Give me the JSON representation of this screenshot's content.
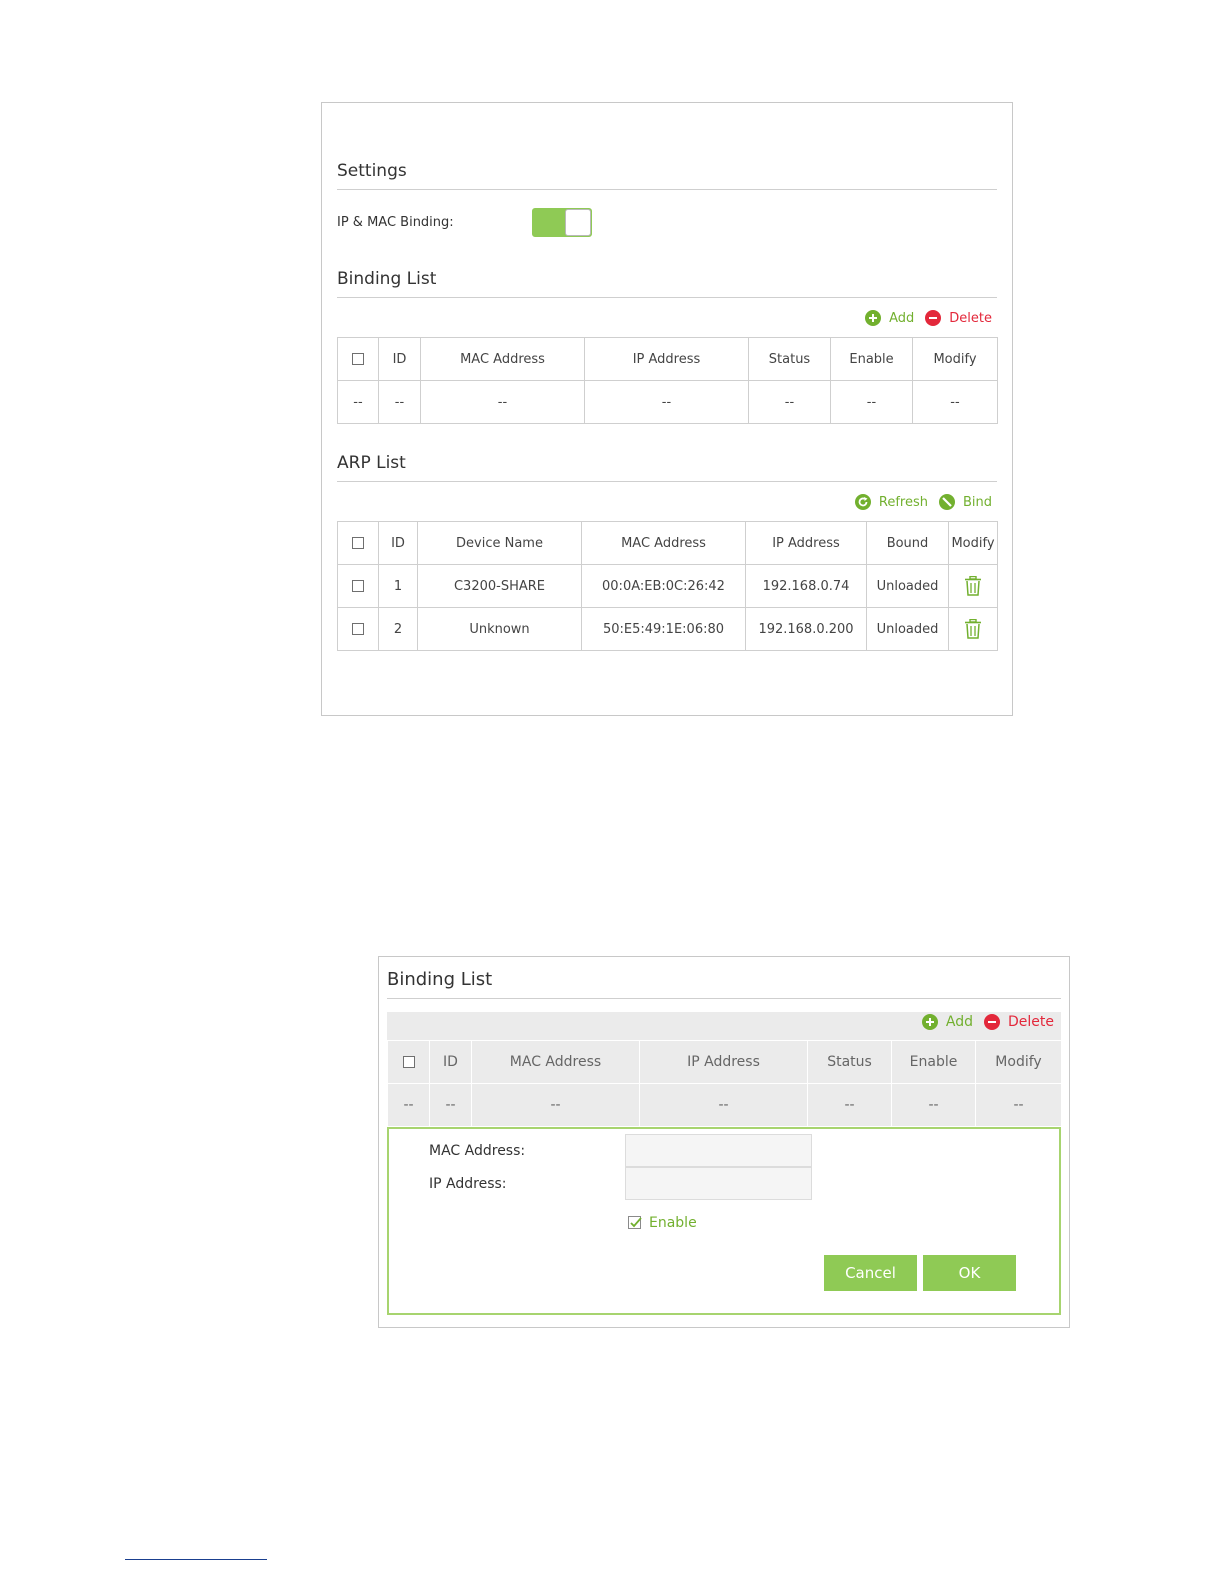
{
  "panel1": {
    "settings": {
      "title": "Settings",
      "binding_label": "IP & MAC Binding:",
      "binding_enabled": true
    },
    "binding_list": {
      "title": "Binding List",
      "actions": {
        "add": "Add",
        "delete": "Delete"
      },
      "columns": [
        "",
        "ID",
        "MAC Address",
        "IP Address",
        "Status",
        "Enable",
        "Modify"
      ],
      "empty_row": [
        "--",
        "--",
        "--",
        "--",
        "--",
        "--",
        "--"
      ]
    },
    "arp_list": {
      "title": "ARP List",
      "actions": {
        "refresh": "Refresh",
        "bind": "Bind"
      },
      "columns": [
        "",
        "ID",
        "Device Name",
        "MAC Address",
        "IP Address",
        "Bound",
        "Modify"
      ],
      "rows": [
        {
          "id": "1",
          "device": "C3200-SHARE",
          "mac": "00:0A:EB:0C:26:42",
          "ip": "192.168.0.74",
          "bound": "Unloaded"
        },
        {
          "id": "2",
          "device": "Unknown",
          "mac": "50:E5:49:1E:06:80",
          "ip": "192.168.0.200",
          "bound": "Unloaded"
        }
      ]
    }
  },
  "panel2": {
    "title": "Binding List",
    "actions": {
      "add": "Add",
      "delete": "Delete"
    },
    "columns": [
      "",
      "ID",
      "MAC Address",
      "IP Address",
      "Status",
      "Enable",
      "Modify"
    ],
    "empty_row": [
      "--",
      "--",
      "--",
      "--",
      "--",
      "--",
      "--"
    ],
    "form": {
      "mac_label": "MAC Address:",
      "ip_label": "IP Address:",
      "mac_value": "",
      "ip_value": "",
      "enable_label": "Enable",
      "enable_checked": true,
      "cancel": "Cancel",
      "ok": "OK"
    }
  },
  "colors": {
    "accent": "#8fca55",
    "accent_text": "#72b02f",
    "danger": "#e3283b"
  },
  "icons": {
    "add": "plus-circle-icon",
    "delete": "minus-circle-icon",
    "refresh": "refresh-icon",
    "bind": "bind-icon",
    "trash": "trash-icon"
  }
}
